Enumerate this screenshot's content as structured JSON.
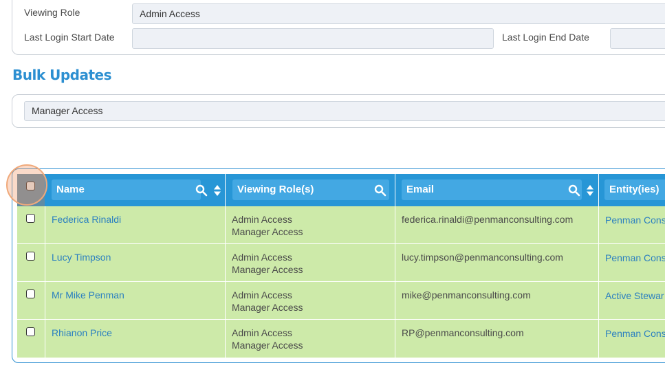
{
  "filters": {
    "viewing_role_label": "Viewing Role",
    "viewing_role_value": "Admin Access",
    "last_login_start_label": "Last Login Start Date",
    "last_login_start_value": "",
    "last_login_end_label": "Last Login End Date",
    "last_login_end_value": ""
  },
  "bulk_updates": {
    "title": "Bulk Updates",
    "role_value": "Manager Access"
  },
  "table": {
    "columns": {
      "name": "Name",
      "viewing_roles": "Viewing Role(s)",
      "email": "Email",
      "entities": "Entity(ies)"
    },
    "rows": [
      {
        "name": "Federica Rinaldi",
        "role1": "Admin Access",
        "role2": "Manager Access",
        "email": "federica.rinaldi@penmanconsulting.com",
        "entity": "Penman Cons"
      },
      {
        "name": "Lucy Timpson",
        "role1": "Admin Access",
        "role2": "Manager Access",
        "email": "lucy.timpson@penmanconsulting.com",
        "entity": "Penman Cons"
      },
      {
        "name": "Mr Mike Penman",
        "role1": "Admin Access",
        "role2": "Manager Access",
        "email": "mike@penmanconsulting.com",
        "entity": "Active Stewar"
      },
      {
        "name": "Rhianon Price",
        "role1": "Admin Access",
        "role2": "Manager Access",
        "email": "RP@penmanconsulting.com",
        "entity": "Penman Cons"
      }
    ]
  },
  "colors": {
    "header_blue": "#2796d6",
    "row_green": "#cdeaa9",
    "title_blue": "#2c8fd1",
    "link_blue": "#2a7fc0"
  }
}
